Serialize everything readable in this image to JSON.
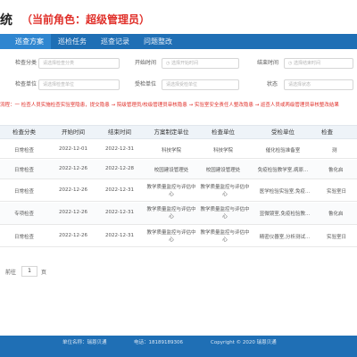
{
  "header": {
    "system_suffix": "统",
    "role_text": "（当前角色：超级管理员）"
  },
  "nav": {
    "tabs": [
      {
        "label": "巡查方案",
        "active": true
      },
      {
        "label": "巡检任务",
        "active": false
      },
      {
        "label": "巡查记录",
        "active": false
      },
      {
        "label": "问题整改",
        "active": false
      }
    ]
  },
  "filters": {
    "row1": [
      {
        "label": "检查分类",
        "placeholder": "请选择检查分类"
      },
      {
        "label": "开始时间",
        "placeholder": "选择开始时间"
      },
      {
        "label": "结束时间",
        "placeholder": "选择结束时间"
      }
    ],
    "row2": [
      {
        "label": "检查单位",
        "placeholder": "请选择检查单位"
      },
      {
        "label": "受检单位",
        "placeholder": "请选择受检单位"
      },
      {
        "label": "状态",
        "placeholder": "请选择状态"
      }
    ]
  },
  "notice": "流程：一 检查人员实施检查实验室隐患，提交隐患 → 院级管理员/校级管理员审核隐患 → 实验室安全责任人整改隐患 → 巡查人员或两级管理员审核整改结果",
  "table": {
    "columns": [
      "检查分类",
      "开始时间",
      "结束时间",
      "方案制定单位",
      "检查单位",
      "受检单位",
      "检查"
    ],
    "rows": [
      [
        "日常检查",
        "2022-12-01",
        "2022-12-31",
        "科技学院",
        "科技学院",
        "催化检验准备室",
        "测"
      ],
      [
        "日常检查",
        "2022-12-26",
        "2022-12-28",
        "校园建设管理处",
        "校园建设管理处",
        "免疫检验教学室,病原...",
        "鲁化启"
      ],
      [
        "日常检查",
        "2022-12-26",
        "2022-12-31",
        "教学质量监控与评估中心",
        "教学质量监控与评估中心",
        "医学检验实验室,免疫...",
        "实验室日"
      ],
      [
        "专项检查",
        "2022-12-26",
        "2022-12-31",
        "教学质量监控与评估中心",
        "教学质量监控与评估中心",
        "显微镜室,免疫检验教...",
        "鲁化启"
      ],
      [
        "日常检查",
        "2022-12-26",
        "2022-12-31",
        "教学质量监控与评估中心",
        "教学质量监控与评估中心",
        "精密仪器室,分析测试...",
        "实验室日"
      ]
    ]
  },
  "pager": {
    "prefix": "前往",
    "page": "1",
    "suffix": "页"
  },
  "footer": {
    "unit": "单位名称：瑞恩贝通",
    "phone": "电话：18189189306",
    "copyright": "Copyright © 2020 瑞恩贝通"
  }
}
